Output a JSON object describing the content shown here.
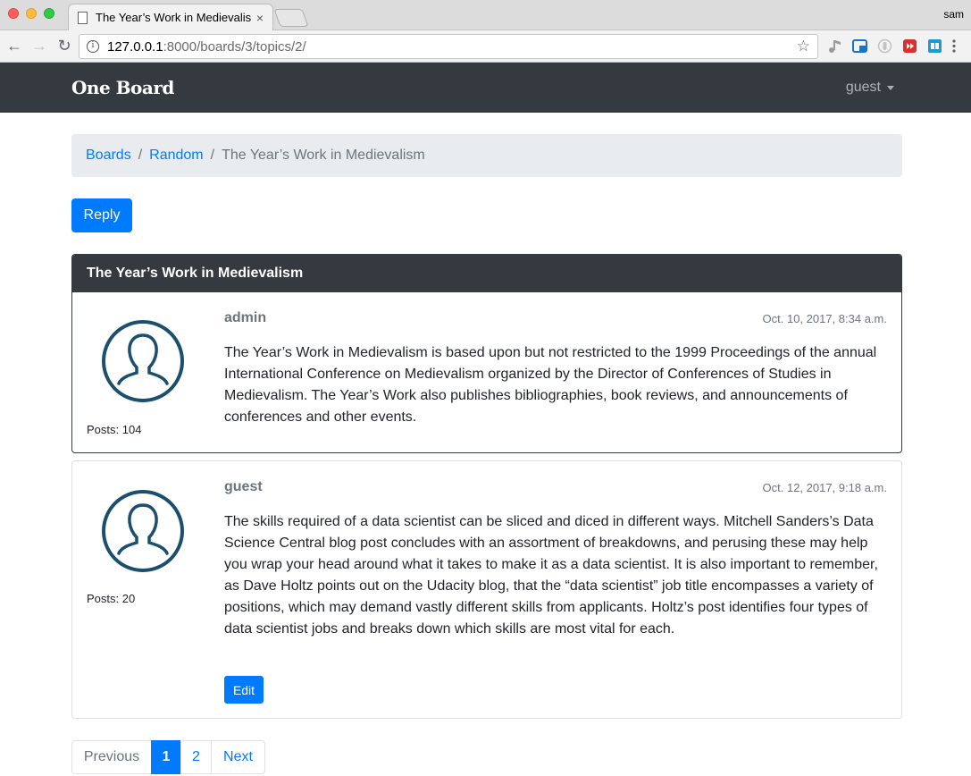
{
  "browser": {
    "tab_title": "The Year’s Work in Medievalism",
    "tab_close": "×",
    "profile": "sam",
    "url_host": "127.0.0.1",
    "url_path": ":8000/boards/3/topics/2/",
    "info_glyph": "i",
    "star_glyph": "☆",
    "back_glyph": "←",
    "forward_glyph": "→",
    "reload_glyph": "↻"
  },
  "navbar": {
    "brand": "One Board",
    "user": "guest"
  },
  "breadcrumb": {
    "items": [
      {
        "label": "Boards"
      },
      {
        "label": "Random"
      }
    ],
    "separator": "/",
    "active": "The Year’s Work in Medievalism"
  },
  "actions": {
    "reply_label": "Reply"
  },
  "topic": {
    "title": "The Year’s Work in Medievalism"
  },
  "posts": [
    {
      "author": "admin",
      "date": "Oct. 10, 2017, 8:34 a.m.",
      "posts_count": "Posts: 104",
      "message": "The Year’s Work in Medievalism is based upon but not restricted to the 1999 Proceedings of the annual International Conference on Medievalism organized by the Director of Conferences of Studies in Medievalism. The Year’s Work also publishes bibliographies, book reviews, and announcements of conferences and other events."
    },
    {
      "author": "guest",
      "date": "Oct. 12, 2017, 9:18 a.m.",
      "posts_count": "Posts: 20",
      "message": "The skills required of a data scientist can be sliced and diced in different ways. Mitchell Sanders’s Data Science Central blog post concludes with an assortment of breakdowns, and perusing these may help you wrap your head around what it takes to make it as a data scientist. It is also important to remember, as Dave Holtz points out on the Udacity blog, that the “data scientist” job title encompasses a variety of positions, which may demand vastly different skills from applicants. Holtz’s post identifies four types of data scientist jobs and breaks down which skills are most vital for each.",
      "edit_label": "Edit"
    }
  ],
  "pagination": {
    "previous": "Previous",
    "pages": [
      "1",
      "2"
    ],
    "current": "1",
    "next": "Next"
  },
  "colors": {
    "primary": "#007bff",
    "navbar": "#343a40",
    "avatar": "#1c4e6e"
  }
}
